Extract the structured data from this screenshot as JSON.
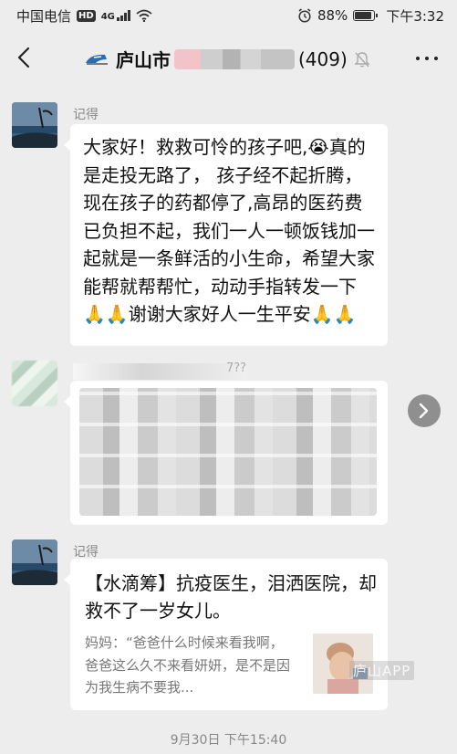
{
  "status_bar": {
    "carrier": "中国电信",
    "hd": "HD",
    "network": "4G",
    "battery_percent": "88%",
    "time": "下午3:32"
  },
  "header": {
    "chat_name": "庐山市",
    "member_count": "(409)"
  },
  "messages": [
    {
      "sender": "记得",
      "text": "大家好！救救可怜的孩子吧,😭真的是走投无路了， 孩子经不起折腾，现在孩子的药都停了,高昂的医药费已负担不起，我们一人一顿饭钱加一起就是一条鲜活的小生命，希望大家能帮就帮帮忙，动动手指转发一下🙏🙏谢谢大家好人一生平安🙏🙏"
    },
    {
      "sender_fragment": "7??"
    },
    {
      "sender": "记得",
      "card_title": "【水滴筹】抗疫医生，泪洒医院，却救不了一岁女儿。",
      "card_desc": "妈妈：“爸爸什么时候来看我啊，爸爸这么久不来看妍妍，是不是因为我生病不要我..."
    }
  ],
  "timestamp": "9月30日 下午15:40",
  "watermark": "庐山APP",
  "colors": {
    "background": "#ededed",
    "bubble": "#ffffff",
    "muted_text": "#888888"
  },
  "icons": [
    "back-icon",
    "train-icon",
    "mute-bell-icon",
    "more-icon",
    "forward-icon",
    "wifi-icon",
    "alarm-icon",
    "battery-icon"
  ]
}
